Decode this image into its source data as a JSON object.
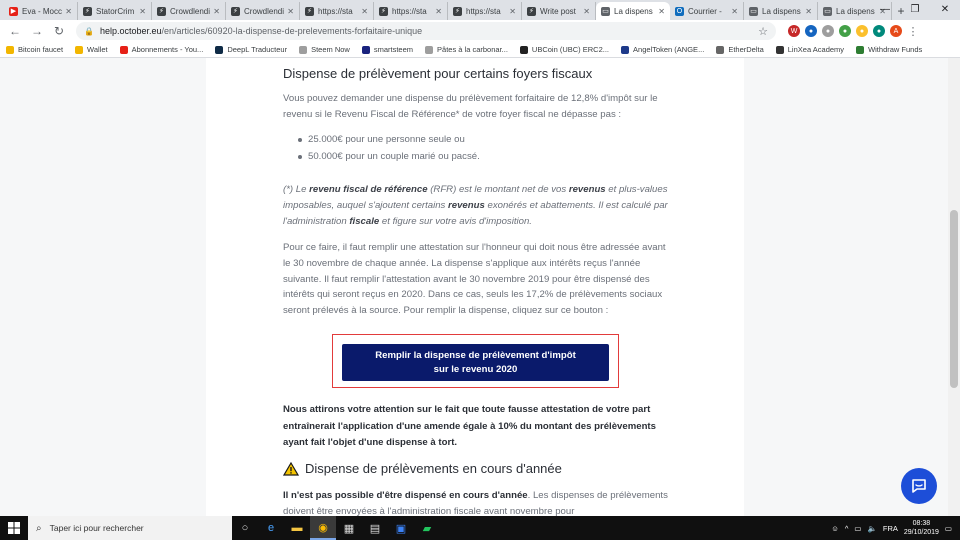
{
  "tabs": [
    {
      "title": "Eva - Mocc",
      "fav_color": "#e62117",
      "fav_glyph": "▶"
    },
    {
      "title": "StatorCrim",
      "fav_color": "#3c4043",
      "fav_glyph": "⚡"
    },
    {
      "title": "Crowdlendi",
      "fav_color": "#3c4043",
      "fav_glyph": "⚡"
    },
    {
      "title": "Crowdlendi",
      "fav_color": "#3c4043",
      "fav_glyph": "⚡"
    },
    {
      "title": "https://sta",
      "fav_color": "#3c4043",
      "fav_glyph": "⚡"
    },
    {
      "title": "https://sta",
      "fav_color": "#3c4043",
      "fav_glyph": "⚡"
    },
    {
      "title": "https://sta",
      "fav_color": "#3c4043",
      "fav_glyph": "⚡"
    },
    {
      "title": "Write post",
      "fav_color": "#3c4043",
      "fav_glyph": "⚡"
    },
    {
      "title": "La dispens",
      "fav_color": "#5f6368",
      "fav_glyph": "▭",
      "active": true
    },
    {
      "title": "Courrier -",
      "fav_color": "#0f6cbd",
      "fav_glyph": "O"
    },
    {
      "title": "La dispens",
      "fav_color": "#5f6368",
      "fav_glyph": "▭"
    },
    {
      "title": "La dispens",
      "fav_color": "#5f6368",
      "fav_glyph": "▭"
    }
  ],
  "address": {
    "host": "help.october.eu",
    "path": "/en/articles/60920-la-dispense-de-prelevements-forfaitaire-unique"
  },
  "bookmarks": [
    {
      "label": "Bitcoin faucet",
      "color": "#f2b600"
    },
    {
      "label": "Wallet",
      "color": "#f2b600"
    },
    {
      "label": "Abonnements - You...",
      "color": "#e62117"
    },
    {
      "label": "DeepL Traducteur",
      "color": "#0f2b46"
    },
    {
      "label": "Steem Now",
      "color": "#9e9e9e"
    },
    {
      "label": "smartsteem",
      "color": "#1a237e"
    },
    {
      "label": "Pâtes à la carbonar...",
      "color": "#9e9e9e"
    },
    {
      "label": "UBCoin (UBC) ERC2...",
      "color": "#222"
    },
    {
      "label": "AngelToken (ANGE...",
      "color": "#1e3a8a"
    },
    {
      "label": "EtherDelta",
      "color": "#666"
    },
    {
      "label": "LinXea Academy",
      "color": "#333"
    },
    {
      "label": "Withdraw Funds",
      "color": "#2e7d32"
    }
  ],
  "article": {
    "heading1": "Dispense de prélèvement pour certains foyers fiscaux",
    "intro": "Vous pouvez demander une dispense du prélèvement forfaitaire de 12,8% d'impôt sur le revenu si le Revenu Fiscal de Référence* de votre foyer fiscal ne dépasse pas :",
    "bullets": [
      "25.000€ pour une personne seule ou",
      "50.000€ pour un couple marié ou pacsé."
    ],
    "note_a": "(*) Le ",
    "note_b1": "revenu fiscal de référence",
    "note_c": " (RFR) est le montant net de vos ",
    "note_b2": "revenus",
    "note_d": " et plus-values imposables, auquel s'ajoutent certains ",
    "note_b3": "revenus",
    "note_e": " exonérés et abattements. Il est calculé par l'administration ",
    "note_b4": "fiscale",
    "note_f": " et figure sur votre avis d'imposition.",
    "para2": "Pour ce faire, il faut remplir une attestation sur l'honneur qui doit nous être adressée avant le 30 novembre de chaque année. La dispense s'applique aux intérêts reçus l'année suivante. Il faut remplir l'attestation avant le 30 novembre 2019 pour être dispensé des intérêts qui seront reçus en 2020. Dans ce cas, seuls les 17,2% de prélèvements sociaux seront prélevés à la source. Pour remplir la dispense, cliquez sur ce bouton :",
    "cta_line1": "Remplir la dispense de prélèvement d'impôt",
    "cta_line2": "sur le revenu 2020",
    "warning_text": "Nous attirons votre attention sur le fait que toute fausse attestation de votre part entraînerait l'application d'une amende égale à 10% du montant des prélèvements ayant fait l'objet d'une dispense à tort.",
    "heading2": "Dispense de prélèvements en cours d'année",
    "last_bold": "Il n'est pas possible d'être dispensé en cours d'année",
    "last_rest": ". Les dispenses de prélèvements doivent être envoyées à l'administration fiscale avant novembre pour"
  },
  "taskbar": {
    "search_placeholder": "Taper ici pour rechercher",
    "lang": "FRA",
    "time": "08:38",
    "date": "29/10/2019"
  },
  "colors": {
    "cta_bg": "#0a1a6b",
    "cta_frame": "#e23b3b",
    "chat_bubble": "#1d4ed8"
  }
}
